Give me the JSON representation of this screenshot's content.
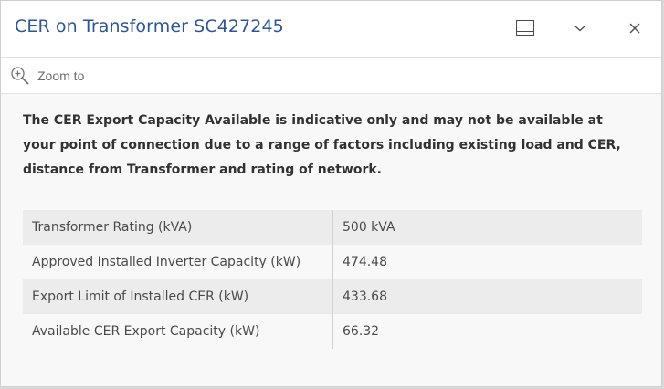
{
  "header": {
    "title": "CER on Transformer SC427245",
    "dock_icon": "dock-icon",
    "collapse_icon": "chevron-down-icon",
    "close_icon": "close-icon"
  },
  "toolbar": {
    "zoom_label": "Zoom to",
    "zoom_icon": "zoom-in-icon"
  },
  "content": {
    "notice": "The CER Export Capacity Available is indicative only and may not be available at your point of connection due to a range of factors including existing load and CER, distance from Transformer and rating of network."
  },
  "attributes": [
    {
      "field": "Transformer Rating (kVA)",
      "value": "500 kVA"
    },
    {
      "field": "Approved Installed Inverter Capacity (kW)",
      "value": "474.48"
    },
    {
      "field": "Export Limit of Installed CER (kW)",
      "value": "433.68"
    },
    {
      "field": "Available CER Export Capacity (kW)",
      "value": "66.32"
    }
  ],
  "colors": {
    "title": "#2b5797",
    "row_alt": "#ececec",
    "row_base": "#f8f8f8"
  }
}
